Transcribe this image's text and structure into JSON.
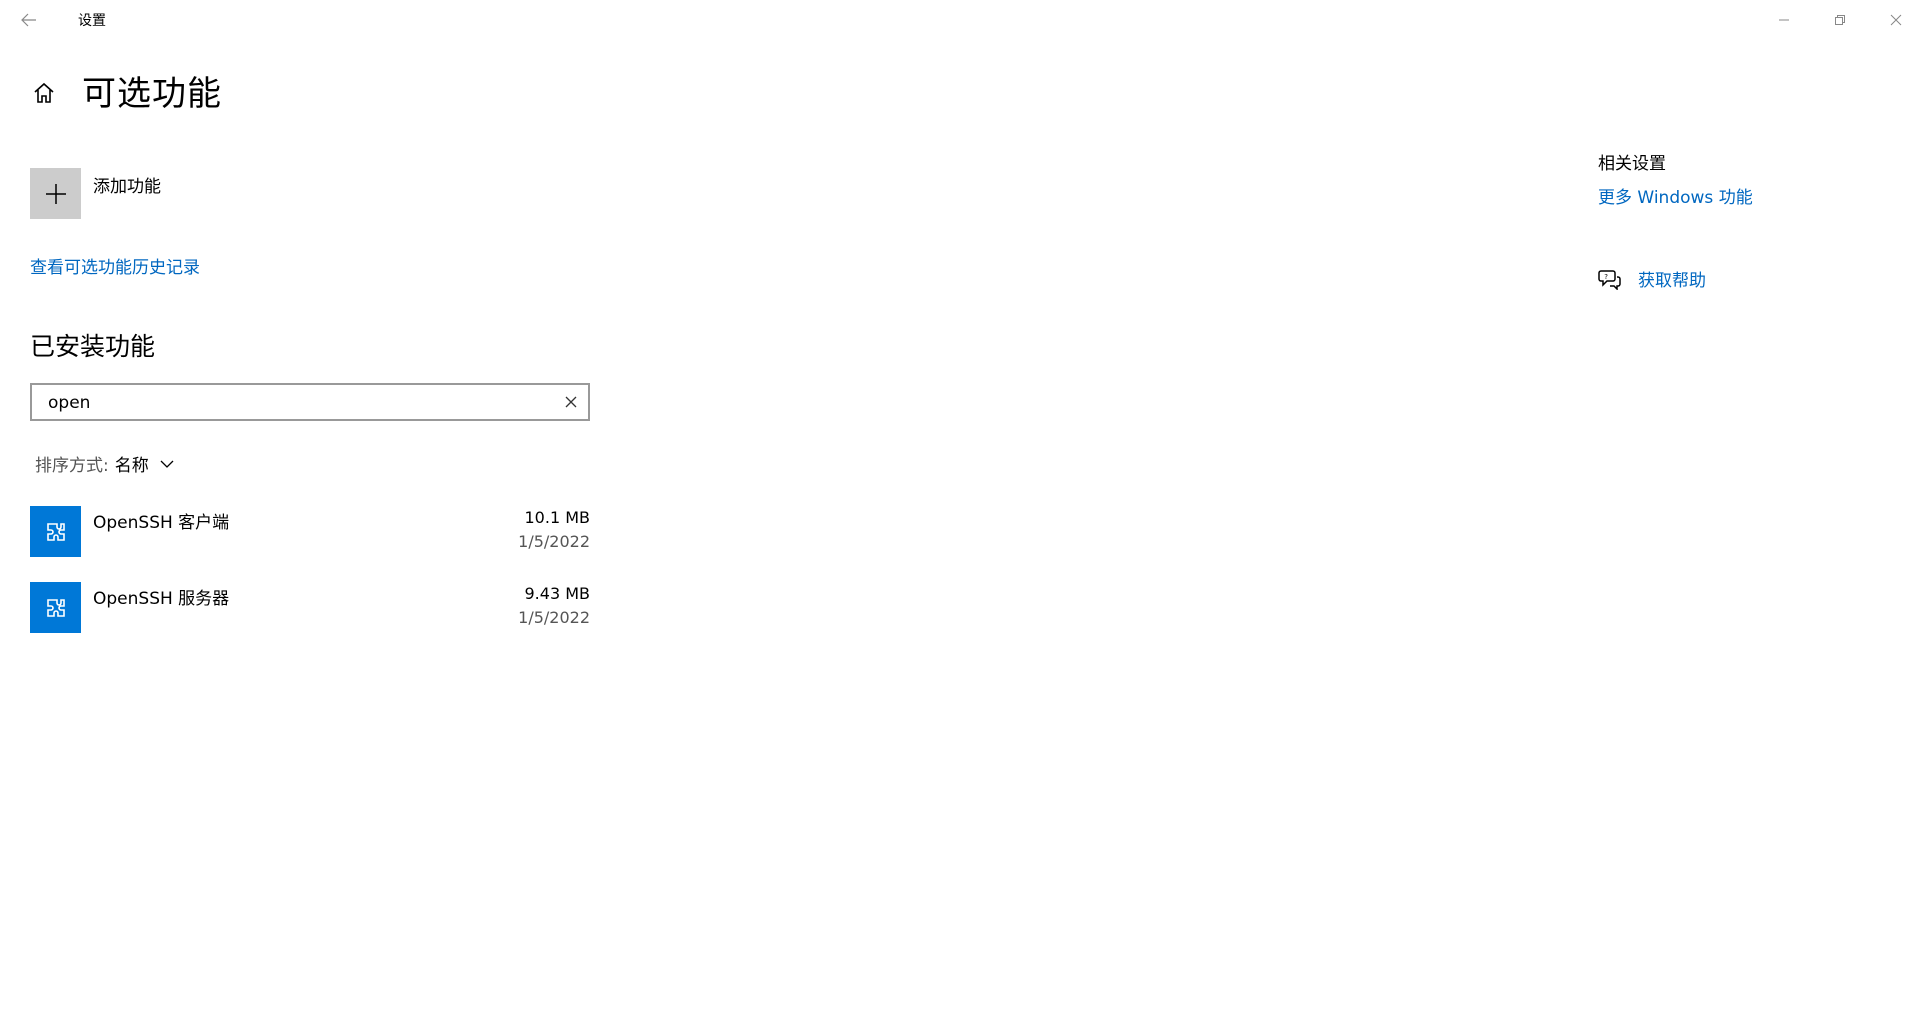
{
  "window": {
    "title": "设置"
  },
  "header": {
    "title": "可选功能"
  },
  "add_feature": {
    "label": "添加功能"
  },
  "history_link": "查看可选功能历史记录",
  "installed": {
    "title": "已安装功能",
    "search": {
      "value": "open",
      "placeholder": ""
    },
    "sort": {
      "label": "排序方式:",
      "value": "名称"
    },
    "items": [
      {
        "name": "OpenSSH 客户端",
        "size": "10.1 MB",
        "date": "1/5/2022",
        "icon": "puzzle-icon"
      },
      {
        "name": "OpenSSH 服务器",
        "size": "9.43 MB",
        "date": "1/5/2022",
        "icon": "puzzle-icon"
      }
    ]
  },
  "related": {
    "title": "相关设置",
    "link": "更多 Windows 功能",
    "help": "获取帮助"
  },
  "colors": {
    "accent": "#0078d7",
    "link": "#0067c0",
    "tile_gray": "#cccccc"
  }
}
